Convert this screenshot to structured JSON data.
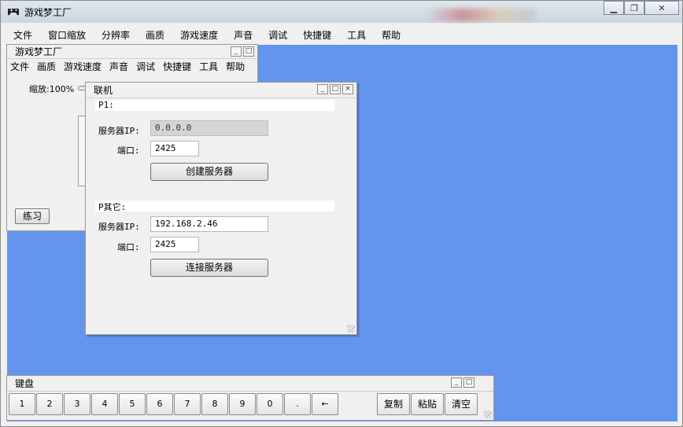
{
  "window": {
    "title": "游戏梦工厂"
  },
  "menubar": [
    "文件",
    "窗口缩放",
    "分辨率",
    "画质",
    "游戏速度",
    "声音",
    "调试",
    "快捷键",
    "工具",
    "帮助"
  ],
  "game_window": {
    "title": "游戏梦工厂",
    "menu": [
      "文件",
      "画质",
      "游戏速度",
      "声音",
      "调试",
      "快捷键",
      "工具",
      "帮助"
    ],
    "zoom_label": "缩放:100%",
    "practice_button": "练习"
  },
  "net_window": {
    "title": "联机",
    "p1_label": "P1:",
    "server_ip_label": "服务器IP:",
    "server_ip_value": "0.0.0.0",
    "port_label": "端口:",
    "port_value_1": "2425",
    "create_button": "创建服务器",
    "p_other_label": "P其它:",
    "server_ip_label_2": "服务器IP:",
    "server_ip_value_2": "192.168.2.46",
    "port_label_2": "端口:",
    "port_value_2": "2425",
    "connect_button": "连接服务器"
  },
  "keyboard_window": {
    "title": "键盘",
    "keys": [
      "1",
      "2",
      "3",
      "4",
      "5",
      "6",
      "7",
      "8",
      "9",
      "0",
      ".",
      "←"
    ],
    "copy": "复制",
    "paste": "粘贴",
    "clear": "清空"
  },
  "colors": {
    "desktop": "#6495ed",
    "chrome": "#f0f0f0"
  },
  "icons": {
    "app": "gamepad-icon",
    "minimize": "minimize-icon",
    "maximize": "maximize-icon",
    "close": "close-icon"
  }
}
